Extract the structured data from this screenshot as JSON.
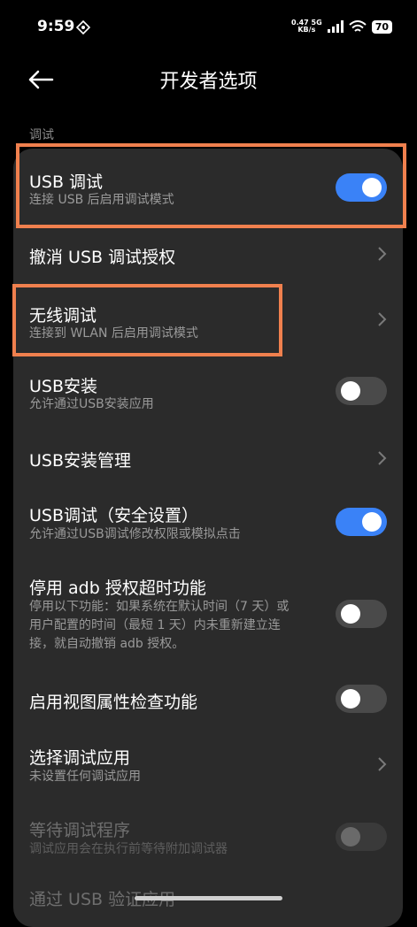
{
  "status_bar": {
    "time": "9:59",
    "net_speed_value": "0.47",
    "net_speed_unit": "KB/s",
    "network": "5G",
    "battery": "70"
  },
  "header": {
    "title": "开发者选项",
    "back_icon": "arrow-left-icon"
  },
  "section_title": "调试",
  "items": [
    {
      "title": "USB 调试",
      "subtitle": "连接 USB 后启用调试模式",
      "control": "toggle",
      "checked": true
    },
    {
      "title": "撤消 USB 调试授权",
      "subtitle": "",
      "control": "chevron"
    },
    {
      "title": "无线调试",
      "subtitle": "连接到 WLAN 后启用调试模式",
      "control": "chevron"
    },
    {
      "title": "USB安装",
      "subtitle": "允许通过USB安装应用",
      "control": "toggle",
      "checked": false
    },
    {
      "title": "USB安装管理",
      "subtitle": "",
      "control": "chevron"
    },
    {
      "title": "USB调试（安全设置）",
      "subtitle": "允许通过USB调试修改权限或模拟点击",
      "control": "toggle",
      "checked": true
    },
    {
      "title": "停用 adb 授权超时功能",
      "subtitle_lines": [
        "停用以下功能：如果系统在默认时间（7 天）或",
        "用户配置的时间（最短 1 天）内未重新建立连",
        "接，就自动撤销 adb 授权。"
      ],
      "control": "toggle",
      "checked": false
    },
    {
      "title": "启用视图属性检查功能",
      "subtitle": "",
      "control": "toggle",
      "checked": false
    },
    {
      "title": "选择调试应用",
      "subtitle": "未设置任何调试应用",
      "control": "chevron"
    },
    {
      "title": "等待调试程序",
      "subtitle": "调试应用会在执行前等待附加调试器",
      "control": "toggle",
      "checked": false,
      "disabled": true
    },
    {
      "title": "通过 USB 验证应用",
      "subtitle": "",
      "control": "none",
      "disabled": true
    }
  ],
  "colors": {
    "accent": "#3a82f7",
    "highlight": "#f0804e",
    "panel": "#2b2b2b",
    "background": "#000000"
  }
}
